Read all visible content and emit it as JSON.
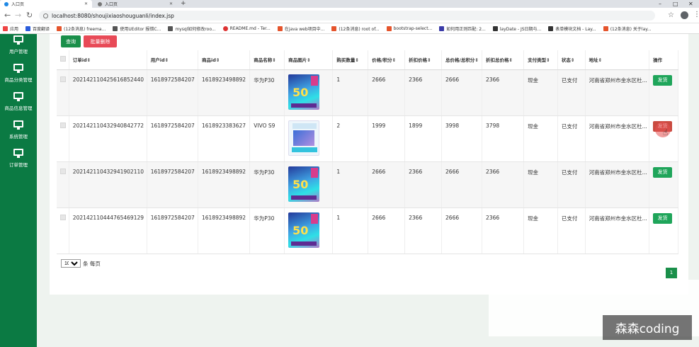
{
  "browser": {
    "tabs": [
      {
        "title": "入口页",
        "active": true
      },
      {
        "title": "入口页",
        "active": false
      }
    ],
    "url": "localhost:8080/shoujixiaoshouguanli/index.jsp",
    "bookmarks": [
      {
        "label": "应用",
        "color": "#e44"
      },
      {
        "label": "百度翻译",
        "color": "#2a5cdb"
      },
      {
        "label": "(12条消息) freema...",
        "color": "#e5542c"
      },
      {
        "label": "使用UEditor 报错C...",
        "color": "#555"
      },
      {
        "label": "mysql如何修改roo...",
        "color": "#555"
      },
      {
        "label": "README.md - Ter...",
        "color": "#d33"
      },
      {
        "label": "在java web项目中...",
        "color": "#e5542c"
      },
      {
        "label": "(12条消息) root of...",
        "color": "#e5542c"
      },
      {
        "label": "bootstrap-select...",
        "color": "#e5542c"
      },
      {
        "label": "如何用正则匹配: 2...",
        "color": "#3b3ba8"
      },
      {
        "label": "layDate - JS日期与...",
        "color": "#333"
      },
      {
        "label": "表单模块文档 - Lay...",
        "color": "#333"
      },
      {
        "label": "(12条消息) 关于lay...",
        "color": "#e5542c"
      }
    ]
  },
  "sidebar": {
    "items": [
      {
        "label": "用户管理"
      },
      {
        "label": "商品分类管理"
      },
      {
        "label": "商品信息管理"
      },
      {
        "label": "系统管理"
      },
      {
        "label": "订单管理"
      }
    ]
  },
  "toolbar": {
    "query_label": "查询",
    "batch_delete_label": "批量删除"
  },
  "table": {
    "headers": [
      "订单id⇕",
      "用户id⇕",
      "商品id⇕",
      "商品名称⇕",
      "商品图片⇕",
      "购买数量⇕",
      "价格/积分⇕",
      "折扣价格⇕",
      "总价格/总积分⇕",
      "折扣总价格⇕",
      "支付类型⇕",
      "状态⇕",
      "地址⇕",
      "操作"
    ],
    "rows": [
      {
        "order_id": "20214211042561685244​0",
        "user_id": "1618972584207",
        "product_id": "1618923498892",
        "name": "华为P30",
        "image": "blue",
        "qty": "1",
        "price": "2666",
        "discount_price": "2366",
        "total": "2666",
        "discount_total": "2366",
        "pay_type": "现金",
        "status": "已支付",
        "address": "河南省郑州市金水区杜...",
        "action": "发货"
      },
      {
        "order_id": "202142110432940842772",
        "user_id": "1618972584207",
        "product_id": "1618923383627",
        "name": "VIVO S9",
        "image": "light",
        "qty": "2",
        "price": "1999",
        "discount_price": "1899",
        "total": "3998",
        "discount_total": "3798",
        "pay_type": "现金",
        "status": "已支付",
        "address": "河南省郑州市金水区杜...",
        "action": "发货"
      },
      {
        "order_id": "202142110432941902110",
        "user_id": "1618972584207",
        "product_id": "1618923498892",
        "name": "华为P30",
        "image": "blue",
        "qty": "1",
        "price": "2666",
        "discount_price": "2366",
        "total": "2666",
        "discount_total": "2366",
        "pay_type": "现金",
        "status": "已支付",
        "address": "河南省郑州市金水区杜...",
        "action": "发货"
      },
      {
        "order_id": "202142110444765469129",
        "user_id": "1618972584207",
        "product_id": "1618923498892",
        "name": "华为P30",
        "image": "blue",
        "qty": "1",
        "price": "2666",
        "discount_price": "2366",
        "total": "2666",
        "discount_total": "2366",
        "pay_type": "现金",
        "status": "已支付",
        "address": "河南省郑州市金水区杜...",
        "action": "发货"
      }
    ]
  },
  "pagination": {
    "page_size": "10",
    "page_size_suffix": "条 每页",
    "current_page": "1"
  },
  "watermark": "森森coding",
  "colors": {
    "sidebar": "#0b7a43",
    "primary": "#1fa55a",
    "danger": "#e84a57"
  }
}
